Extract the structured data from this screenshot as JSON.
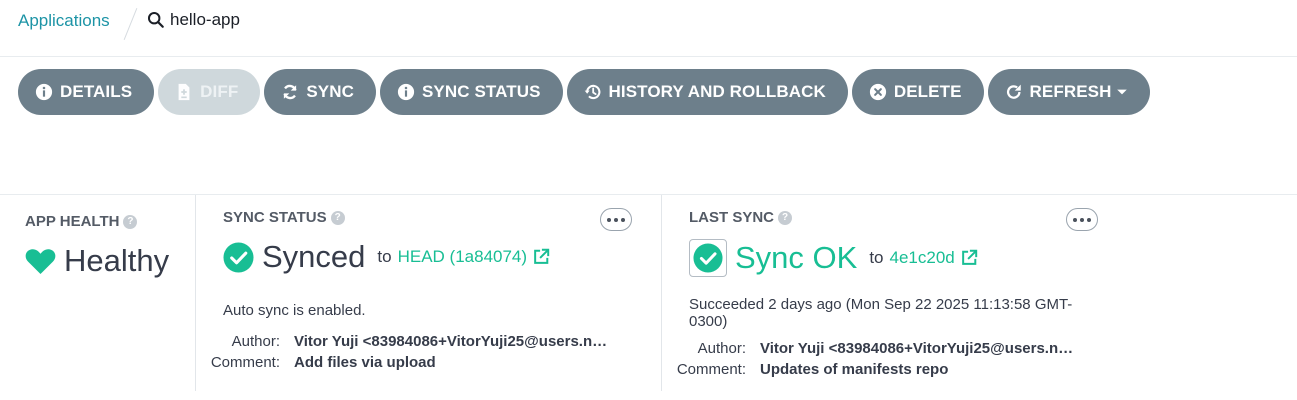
{
  "breadcrumb": {
    "parent_label": "Applications",
    "current_label": "hello-app"
  },
  "toolbar": {
    "buttons": [
      {
        "label": "DETAILS",
        "icon": "info-circle-icon",
        "disabled": false
      },
      {
        "label": "DIFF",
        "icon": "file-diff-icon",
        "disabled": true
      },
      {
        "label": "SYNC",
        "icon": "sync-icon",
        "disabled": false
      },
      {
        "label": "SYNC STATUS",
        "icon": "info-circle-icon",
        "disabled": false
      },
      {
        "label": "HISTORY AND ROLLBACK",
        "icon": "history-icon",
        "disabled": false
      },
      {
        "label": "DELETE",
        "icon": "times-circle-icon",
        "disabled": false
      },
      {
        "label": "REFRESH",
        "icon": "redo-icon",
        "disabled": false,
        "has_caret": true
      }
    ]
  },
  "app_health": {
    "title": "APP HEALTH",
    "status": "Healthy",
    "icon": "heart-icon",
    "color": "#18be94"
  },
  "sync_status": {
    "title": "SYNC STATUS",
    "status": "Synced",
    "to_label": "to",
    "revision": "HEAD (1a84074)",
    "note": "Auto sync is enabled.",
    "author_label": "Author:",
    "author": "Vitor Yuji <83984086+VitorYuji25@users.no...",
    "comment_label": "Comment:",
    "comment": "Add files via upload",
    "status_color": "#363c4a",
    "icon_color": "#18be94"
  },
  "last_sync": {
    "title": "LAST SYNC",
    "status": "Sync OK",
    "to_label": "to",
    "revision": "4e1c20d",
    "note": "Succeeded 2 days ago (Mon Sep 22 2025 11:13:58 GMT-0300)",
    "author_label": "Author:",
    "author": "Vitor Yuji <83984086+VitorYuji25@users.no...",
    "comment_label": "Comment:",
    "comment": "Updates of manifests repo",
    "status_color": "#18be94"
  },
  "colors": {
    "accent": "#18be94",
    "link": "#1d94a6",
    "button": "#6d7f8b",
    "button_disabled": "#cfd8dc"
  }
}
